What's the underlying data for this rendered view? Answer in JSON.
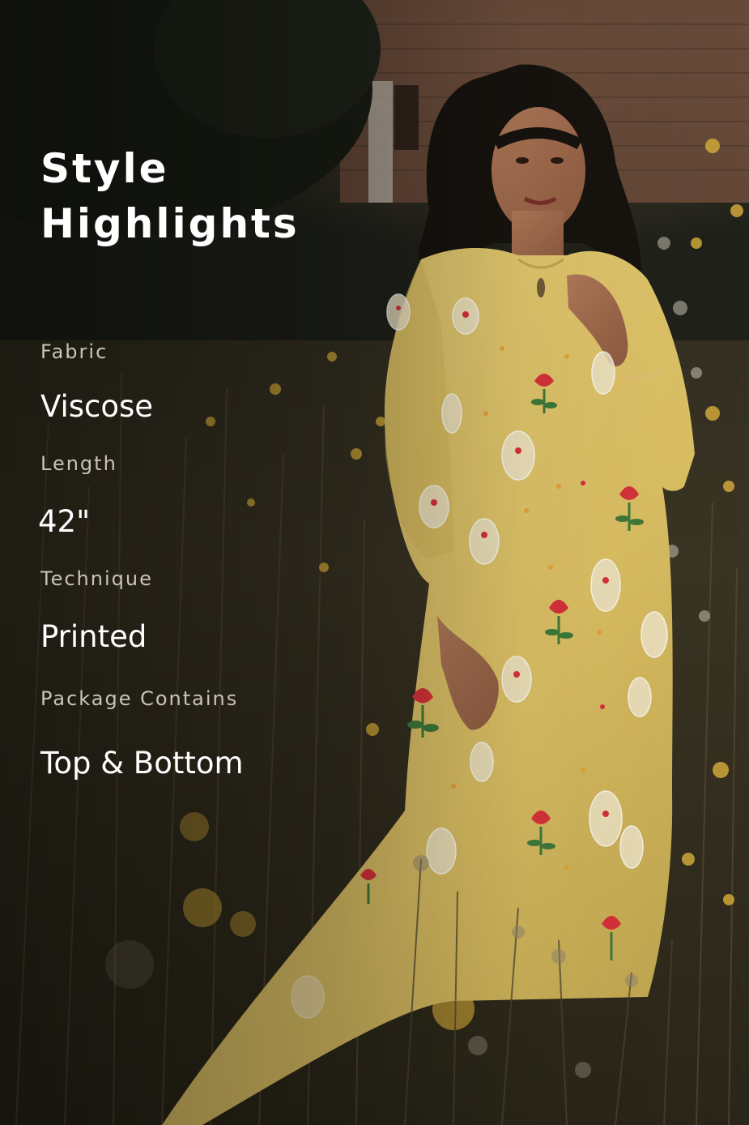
{
  "heading": {
    "line1": "Style",
    "line2": "Highlights"
  },
  "specs": [
    {
      "label": "Fabric",
      "value": "Viscose"
    },
    {
      "label": "Length",
      "value": "42\""
    },
    {
      "label": "Technique",
      "value": "Printed"
    },
    {
      "label": "Package Contains",
      "value": "Top & Bottom"
    }
  ],
  "colors": {
    "kurta": "#e3c86a",
    "motif_red": "#d7333a",
    "leaf_green": "#3f7a3a",
    "text_primary": "#ffffff",
    "text_label": "#c9c4b6"
  }
}
